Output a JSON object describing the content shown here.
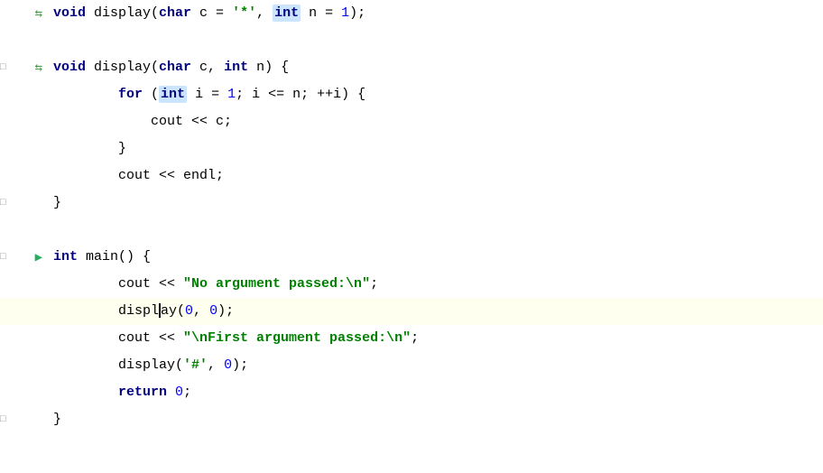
{
  "editor": {
    "background": "#ffffff",
    "highlight_color": "#fffff0",
    "lines": [
      {
        "id": 1,
        "type": "code",
        "gutter": "swap",
        "highlighted": false,
        "parts": [
          {
            "type": "kw",
            "text": "void"
          },
          {
            "type": "plain",
            "text": " display("
          },
          {
            "type": "kw",
            "text": "char"
          },
          {
            "type": "plain",
            "text": " c = "
          },
          {
            "type": "str",
            "text": "'*'"
          },
          {
            "type": "plain",
            "text": ", "
          },
          {
            "type": "hl-kw",
            "text": "int"
          },
          {
            "type": "plain",
            "text": " n = "
          },
          {
            "type": "num",
            "text": "1"
          },
          {
            "type": "plain",
            "text": ");"
          }
        ]
      },
      {
        "id": 2,
        "type": "empty",
        "gutter": "",
        "highlighted": false,
        "parts": []
      },
      {
        "id": 3,
        "type": "code",
        "gutter": "swap",
        "fold": true,
        "highlighted": false,
        "parts": [
          {
            "type": "kw",
            "text": "void"
          },
          {
            "type": "plain",
            "text": " display("
          },
          {
            "type": "kw",
            "text": "char"
          },
          {
            "type": "plain",
            "text": " c, "
          },
          {
            "type": "kw",
            "text": "int"
          },
          {
            "type": "plain",
            "text": " n) {"
          }
        ]
      },
      {
        "id": 4,
        "type": "code",
        "gutter": "",
        "highlighted": false,
        "parts": [
          {
            "type": "plain",
            "text": "        "
          },
          {
            "type": "kw",
            "text": "for"
          },
          {
            "type": "plain",
            "text": " ("
          },
          {
            "type": "hl-kw",
            "text": "int"
          },
          {
            "type": "plain",
            "text": " i = "
          },
          {
            "type": "num",
            "text": "1"
          },
          {
            "type": "plain",
            "text": "; i <= n; ++i) {"
          }
        ]
      },
      {
        "id": 5,
        "type": "code",
        "gutter": "",
        "highlighted": false,
        "parts": [
          {
            "type": "plain",
            "text": "            cout << c;"
          }
        ]
      },
      {
        "id": 6,
        "type": "code",
        "gutter": "",
        "highlighted": false,
        "parts": [
          {
            "type": "plain",
            "text": "        }"
          }
        ]
      },
      {
        "id": 7,
        "type": "code",
        "gutter": "",
        "highlighted": false,
        "parts": [
          {
            "type": "plain",
            "text": "        cout << endl;"
          }
        ]
      },
      {
        "id": 8,
        "type": "code",
        "gutter": "fold",
        "highlighted": false,
        "parts": [
          {
            "type": "plain",
            "text": "}"
          }
        ]
      },
      {
        "id": 9,
        "type": "empty",
        "gutter": "",
        "highlighted": false,
        "parts": []
      },
      {
        "id": 10,
        "type": "code",
        "gutter": "arrow",
        "fold": true,
        "highlighted": false,
        "parts": [
          {
            "type": "kw",
            "text": "int"
          },
          {
            "type": "plain",
            "text": " main() {"
          }
        ]
      },
      {
        "id": 11,
        "type": "code",
        "gutter": "",
        "highlighted": false,
        "parts": [
          {
            "type": "plain",
            "text": "        cout << "
          },
          {
            "type": "str",
            "text": "\"No argument passed:\\n\""
          },
          {
            "type": "plain",
            "text": ";"
          }
        ]
      },
      {
        "id": 12,
        "type": "code",
        "gutter": "",
        "highlighted": true,
        "parts": [
          {
            "type": "plain",
            "text": "        displ"
          },
          {
            "type": "cursor",
            "text": ""
          },
          {
            "type": "plain",
            "text": "ay("
          },
          {
            "type": "num",
            "text": "0"
          },
          {
            "type": "plain",
            "text": ", "
          },
          {
            "type": "num",
            "text": "0"
          },
          {
            "type": "plain",
            "text": ");"
          }
        ]
      },
      {
        "id": 13,
        "type": "code",
        "gutter": "",
        "highlighted": false,
        "parts": [
          {
            "type": "plain",
            "text": "        cout << "
          },
          {
            "type": "str",
            "text": "\"\\nFirst argument passed:\\n\""
          },
          {
            "type": "plain",
            "text": ";"
          }
        ]
      },
      {
        "id": 14,
        "type": "code",
        "gutter": "",
        "highlighted": false,
        "parts": [
          {
            "type": "plain",
            "text": "        display("
          },
          {
            "type": "str",
            "text": "'#'"
          },
          {
            "type": "plain",
            "text": ", "
          },
          {
            "type": "num",
            "text": "0"
          },
          {
            "type": "plain",
            "text": ");"
          }
        ]
      },
      {
        "id": 15,
        "type": "code",
        "gutter": "",
        "highlighted": false,
        "parts": [
          {
            "type": "plain",
            "text": "        "
          },
          {
            "type": "kw",
            "text": "return"
          },
          {
            "type": "plain",
            "text": " "
          },
          {
            "type": "num",
            "text": "0"
          },
          {
            "type": "plain",
            "text": ";"
          }
        ]
      },
      {
        "id": 16,
        "type": "code",
        "gutter": "fold",
        "highlighted": false,
        "parts": [
          {
            "type": "plain",
            "text": "}"
          }
        ]
      },
      {
        "id": 17,
        "type": "empty",
        "gutter": "",
        "highlighted": false,
        "parts": []
      }
    ]
  }
}
